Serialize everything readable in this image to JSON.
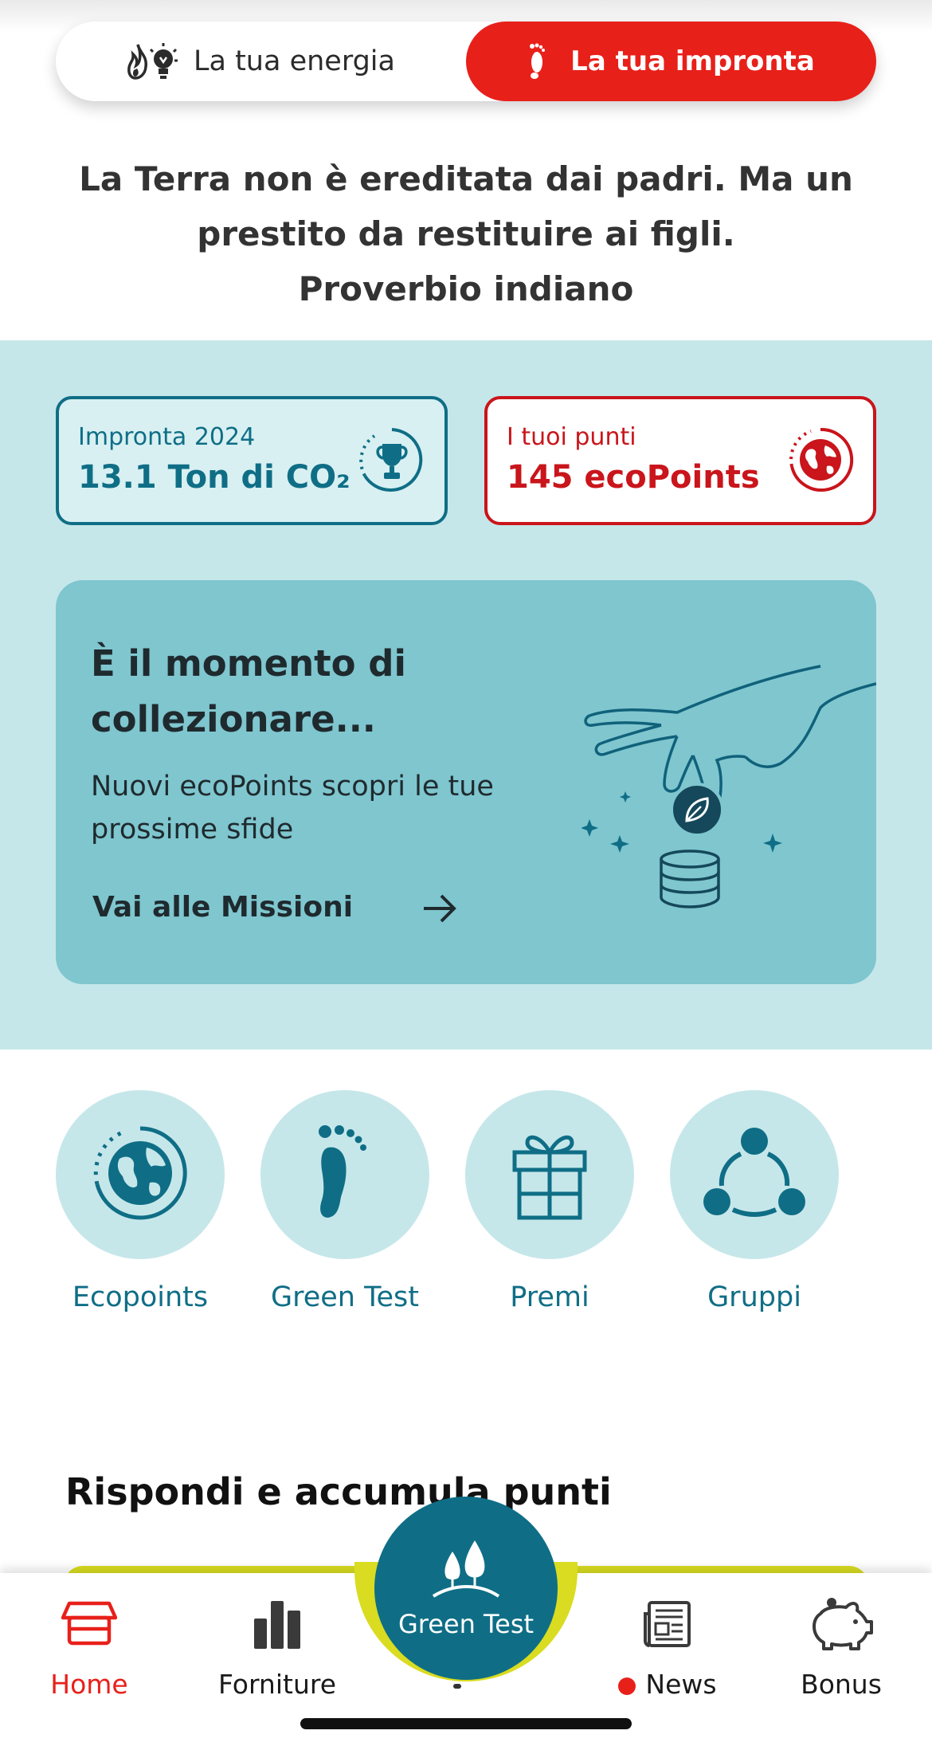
{
  "switch": {
    "energy_label": "La tua energia",
    "footprint_label": "La tua impronta",
    "active": "footprint"
  },
  "quote": {
    "line1": "La Terra non è ereditata dai padri. Ma un",
    "line2": "prestito da restituire ai figli.",
    "line3": "Proverbio indiano"
  },
  "stats": {
    "footprint_label": "Impronta 2024",
    "footprint_value": "13.1 Ton di CO₂",
    "points_label": "I tuoi punti",
    "points_value": "145 ecoPoints"
  },
  "promo": {
    "title": "È il momento di collezionare...",
    "subtitle": "Nuovi ecoPoints scopri le tue prossime sfide",
    "link": "Vai alle Missioni"
  },
  "quick_links": [
    {
      "label": "Ecopoints",
      "icon": "globe-icon"
    },
    {
      "label": "Green Test",
      "icon": "footprint-icon"
    },
    {
      "label": "Premi",
      "icon": "gift-icon"
    },
    {
      "label": "Gruppi",
      "icon": "group-icon"
    }
  ],
  "section": {
    "title": "Rispondi e accumula punti"
  },
  "nav": {
    "home": "Home",
    "supplies": "Forniture",
    "center": "Green Test",
    "news": "News",
    "bonus": "Bonus",
    "active": "home"
  },
  "colors": {
    "brand_red": "#e8201a",
    "teal": "#0f6e86",
    "teal_light": "#c6e7ea",
    "promo_bg": "#7fc6cf",
    "accent_yellow": "#d9dc20"
  }
}
